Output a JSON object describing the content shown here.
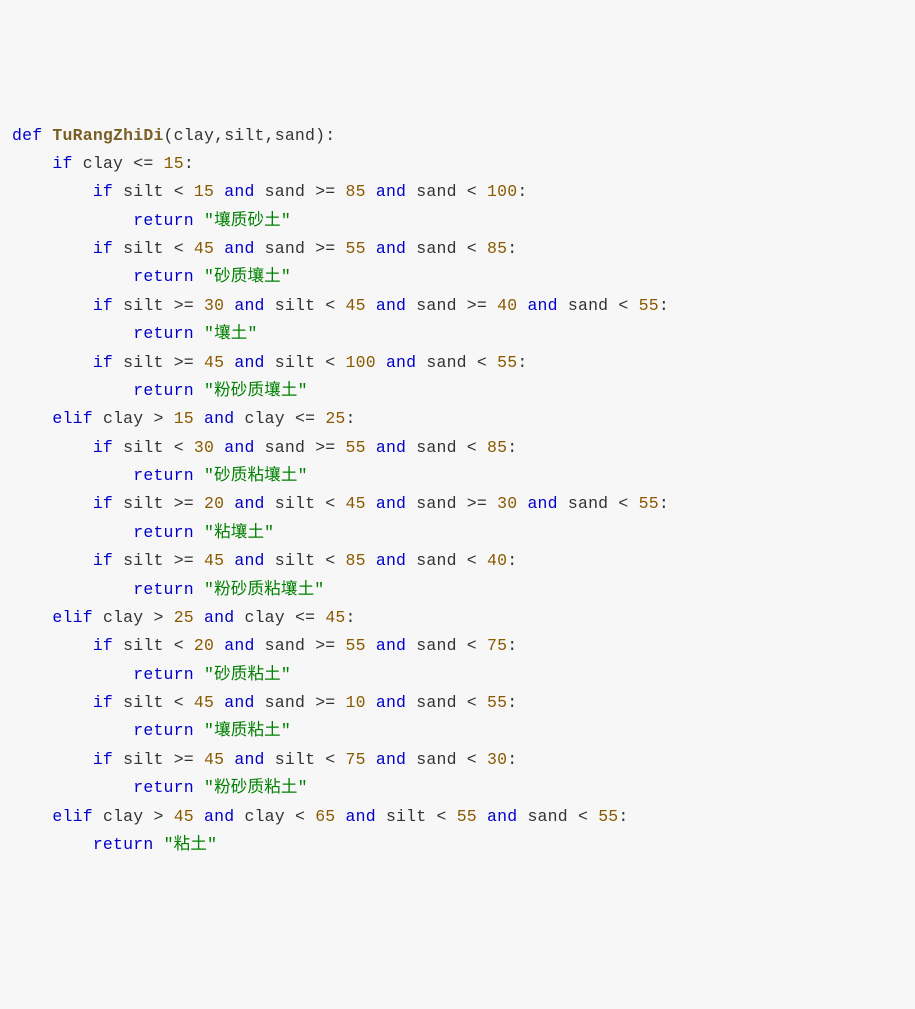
{
  "function_name": "TuRangZhiDi",
  "params": [
    "clay",
    "silt",
    "sand"
  ],
  "tokens": {
    "def": "def",
    "if": "if",
    "elif": "elif",
    "return": "return",
    "and": "and"
  },
  "numbers": {
    "n10": "10",
    "n15": "15",
    "n20": "20",
    "n25": "25",
    "n30": "30",
    "n40": "40",
    "n45": "45",
    "n55": "55",
    "n65": "65",
    "n75": "75",
    "n85": "85",
    "n100": "100"
  },
  "strings": {
    "s_rangzhishatu": "\"壤质砂土\"",
    "s_shazhirangtu": "\"砂质壤土\"",
    "s_rangtu": "\"壤土\"",
    "s_fenshazhirangtu": "\"粉砂质壤土\"",
    "s_shazhinianrangtu": "\"砂质粘壤土\"",
    "s_nianrangtu": "\"粘壤土\"",
    "s_fenshazhinianrangtu": "\"粉砂质粘壤土\"",
    "s_shazhiniantu": "\"砂质粘土\"",
    "s_rangzhiniantu": "\"壤质粘土\"",
    "s_fenshazhiniantu": "\"粉砂质粘土\"",
    "s_niantu": "\"粘土\""
  }
}
